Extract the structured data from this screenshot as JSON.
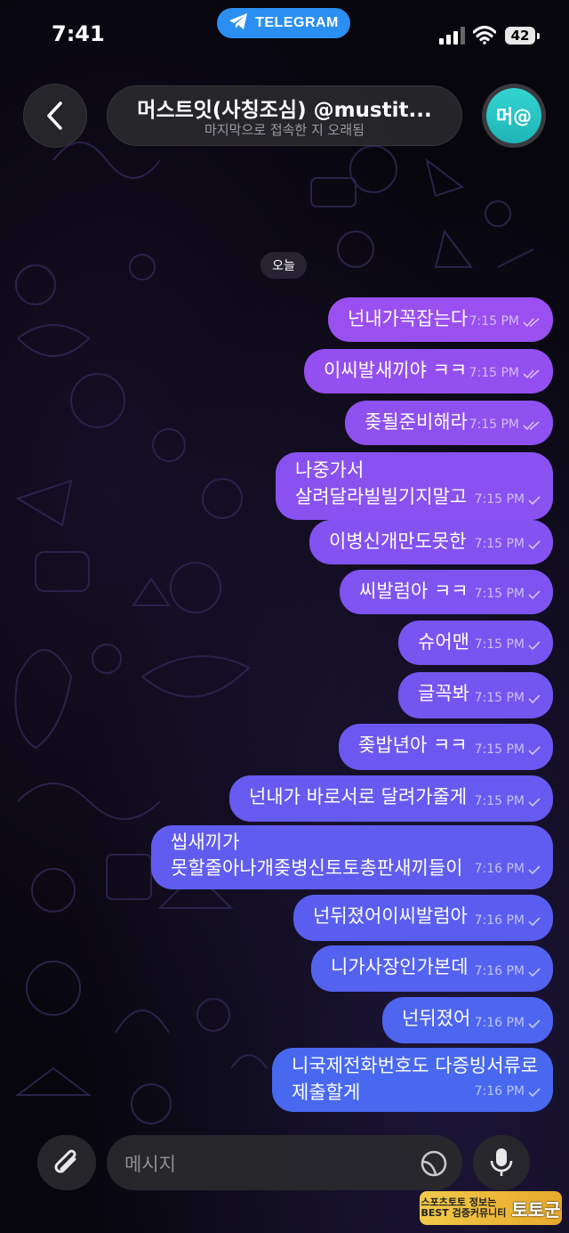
{
  "status_bar": {
    "time": "7:41",
    "app_pill": "TELEGRAM",
    "battery": "42"
  },
  "header": {
    "chat_name": "머스트잇(사칭조심) @mustit...",
    "last_seen": "마지막으로 접속한 지 오래됨",
    "avatar_initials": "머@"
  },
  "date_chip": "오늘",
  "messages": [
    {
      "text": "넌내가꼭잡는다",
      "time": "7:15 PM"
    },
    {
      "text": "이씨발새끼야 ㅋㅋ",
      "time": "7:15 PM"
    },
    {
      "text": "좆될준비해라",
      "time": "7:15 PM"
    },
    {
      "text": "나중가서",
      "text2": "살려달라빌빌기지말고",
      "time": "7:15 PM"
    },
    {
      "text": "이병신개만도못한",
      "time": "7:15 PM"
    },
    {
      "text": "씨발럼아 ㅋㅋ",
      "time": "7:15 PM"
    },
    {
      "text": "슈어맨",
      "time": "7:15 PM"
    },
    {
      "text": "글꼭봐",
      "time": "7:15 PM"
    },
    {
      "text": "좆밥년아 ㅋㅋ",
      "time": "7:15 PM"
    },
    {
      "text": "넌내가 바로서로 달려가줄게",
      "time": "7:15 PM"
    },
    {
      "text": "씹새끼가",
      "text2": "못할줄아나개좆병신토토총판새끼들이",
      "time": "7:16 PM"
    },
    {
      "text": "넌뒤졌어이씨발럼아",
      "time": "7:16 PM"
    },
    {
      "text": "니가사장인가본데",
      "time": "7:16 PM"
    },
    {
      "text": "넌뒤졌어",
      "time": "7:16 PM"
    },
    {
      "text": "니국제전화번호도 다증빙서류로",
      "text2": "제출할게",
      "time": "7:16 PM"
    }
  ],
  "input": {
    "placeholder": "메시지"
  },
  "watermark": {
    "line1": "스포츠토토 정보는",
    "line2": "BEST 검증커뮤니티",
    "brand": "토토군"
  },
  "colors": {
    "bubble_top": "#9a4ff0",
    "bubble_mid": "#7a57ee",
    "bubble_bottom": "#4a6cf0",
    "telegram_blue": "#2a8ff0",
    "avatar": "#26c4c4"
  },
  "icons": [
    "telegram-plane-icon",
    "signal-icon",
    "wifi-icon",
    "back-chevron-icon",
    "read-double-check-icon",
    "sent-check-icon",
    "paperclip-icon",
    "sticker-icon",
    "microphone-icon"
  ]
}
